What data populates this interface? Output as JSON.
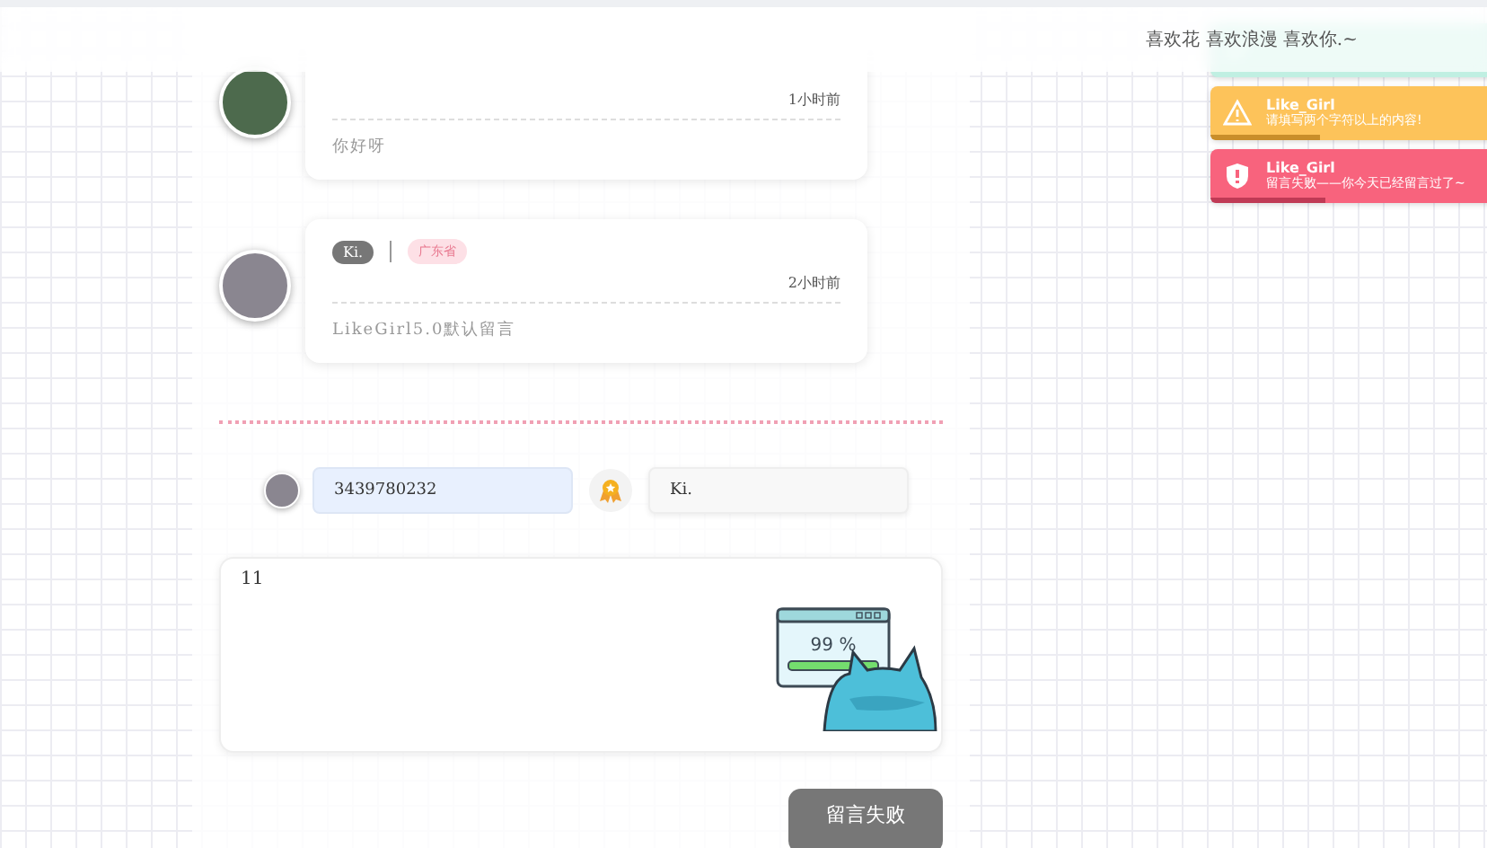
{
  "navbar": {
    "slogan": "喜欢花 喜欢浪漫 喜欢你.~"
  },
  "comments": [
    {
      "time": "1小时前",
      "text": "你好呀"
    },
    {
      "name": "Ki.",
      "location": "广东省",
      "time": "2小时前",
      "text": "LikeGirl5.0默认留言"
    }
  ],
  "form": {
    "qq": "3439780232",
    "nickname": "Ki.",
    "message": "11",
    "illustration_label": "99 %",
    "submit": "留言失败"
  },
  "toasts": [
    {
      "kind": "success"
    },
    {
      "kind": "warning",
      "title": "Like_Girl",
      "message": "请填写两个字符以上的内容!",
      "level": 0.38
    },
    {
      "kind": "error",
      "title": "Like_Girl",
      "message": "留言失败——你今天已经留言过了~",
      "level": 0.4
    }
  ]
}
